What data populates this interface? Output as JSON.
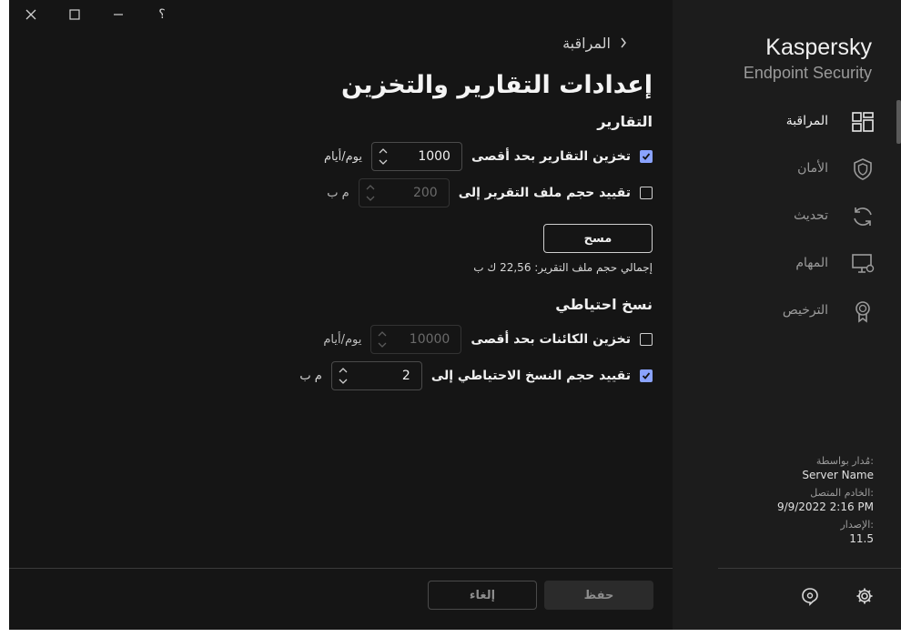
{
  "window_controls": {
    "help": "؟"
  },
  "app": {
    "name": "Kaspersky",
    "product": "Endpoint Security"
  },
  "nav": [
    {
      "label": "المراقبة",
      "icon": "dashboard-icon",
      "active": true
    },
    {
      "label": "الأمان",
      "icon": "shield-icon",
      "active": false
    },
    {
      "label": "تحديث",
      "icon": "refresh-icon",
      "active": false
    },
    {
      "label": "المهام",
      "icon": "monitor-gear-icon",
      "active": false
    },
    {
      "label": "الترخيص",
      "icon": "license-badge-icon",
      "active": false
    }
  ],
  "info": {
    "managed_by_label": "مُدار بواسطة:",
    "managed_by_value": "Server Name",
    "server_label": "الخادم المتصل:",
    "server_value": "9/9/2022 2:16 PM",
    "version_label": "الإصدار:",
    "version_value": "11.5"
  },
  "breadcrumb": "المراقبة",
  "page_title": "إعدادات التقارير والتخزين",
  "reports": {
    "section_title": "التقارير",
    "store_reports": {
      "label": "تخزين التقارير بحد أقصى",
      "checked": true,
      "value": "1000",
      "unit": "يوم/أيام"
    },
    "limit_size": {
      "label": "تقييد حجم ملف التقرير إلى",
      "checked": false,
      "value": "200",
      "unit": "م ب"
    },
    "clear_button": "مسح",
    "total_size": "إجمالي حجم ملف التقرير: 22,56 ك ب"
  },
  "backup": {
    "section_title": "نسخ احتياطي",
    "store_objects": {
      "label": "تخزين الكائنات بحد أقصى",
      "checked": false,
      "value": "10000",
      "unit": "يوم/أيام"
    },
    "limit_backup": {
      "label": "تقييد حجم النسخ الاحتياطي إلى",
      "checked": true,
      "value": "2",
      "unit": "م ب"
    }
  },
  "footer": {
    "save": "حفظ",
    "cancel": "إلغاء"
  },
  "colors": {
    "accent": "#8aa3ff",
    "background": "#151515",
    "sidebar": "#1c1c1c"
  }
}
